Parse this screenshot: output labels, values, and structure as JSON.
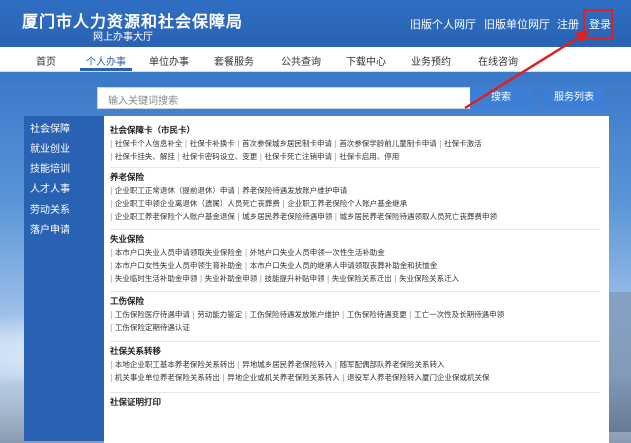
{
  "header": {
    "title": "厦门市人力资源和社会保障局",
    "subtitle": "网上办事大厅",
    "links": [
      "旧版个人网厅",
      "旧版单位网厅",
      "注册",
      "登录"
    ]
  },
  "nav": {
    "items": [
      "首页",
      "个人办事",
      "单位办事",
      "套餐服务",
      "公共查询",
      "下载中心",
      "业务预约",
      "在线咨询"
    ],
    "active": "个人办事"
  },
  "search": {
    "placeholder": "输入关键词搜索",
    "button": "搜索",
    "service_button": "服务列表"
  },
  "sidebar": {
    "items": [
      "社会保障",
      "就业创业",
      "技能培训",
      "人才人事",
      "劳动关系",
      "落户申请"
    ]
  },
  "sections": [
    {
      "title": "社会保障卡（市民卡）",
      "lines": [
        [
          "社保卡个人信息补全",
          "社保卡补换卡",
          "首次参保城乡居民制卡申请",
          "首次参保学龄前儿童制卡申请",
          "社保卡激活"
        ],
        [
          "社保卡挂失、解挂",
          "社保卡密码设立、变更",
          "社保卡死亡注销申请",
          "社保卡启用、停用"
        ]
      ]
    },
    {
      "title": "养老保险",
      "lines": [
        [
          "企业职工正常退休（提前退休）申请",
          "养老保险待遇发放账户维护申请"
        ],
        [
          "企业职工申领企业离退休（遗属）人员死亡丧葬费",
          "企业职工养老保险个人账户基金继承"
        ],
        [
          "企业职工养老保险个人账户基金退保",
          "城乡居民养老保险待遇申领",
          "城乡居民养老保险待遇领取人员死亡丧葬费申领"
        ]
      ]
    },
    {
      "title": "失业保险",
      "lines": [
        [
          "本市户口失业人员申请领取失业保险金",
          "外地户口失业人员申领一次性生活补助金"
        ],
        [
          "本市户口女性失业人员申领生育补助金",
          "本市户口失业人员的继承人申请领取丧葬补助金和抚恤金"
        ],
        [
          "失业临时生活补助金申领",
          "失业补助金申领",
          "技能提升补贴申领",
          "失业保险关系迁出",
          "失业保险关系迁入"
        ]
      ]
    },
    {
      "title": "工伤保险",
      "lines": [
        [
          "工伤保险医疗待遇申请",
          "劳动能力鉴定",
          "工伤保险待遇发放账户维护",
          "工伤保险待遇变更",
          "工亡一次性及长期待遇申领"
        ],
        [
          "工伤保险定期待遇认证"
        ]
      ]
    },
    {
      "title": "社保关系转移",
      "lines": [
        [
          "本地企业职工基本养老保险关系转出",
          "异地城乡居民养老保险转入",
          "随军配偶部队养老保险关系转入"
        ],
        [
          "机关事业单位养老保险关系转出",
          "异地企业或机关养老保险关系转入",
          "退役军人养老保险转入厦门企业保或机关保"
        ]
      ]
    },
    {
      "title": "社保证明打印",
      "lines": []
    }
  ],
  "colors": {
    "header_bg": "#2a62b3",
    "accent": "#3c7fd6",
    "highlight": "#e02020"
  },
  "icons": [
    "arrow-annotation-icon"
  ]
}
